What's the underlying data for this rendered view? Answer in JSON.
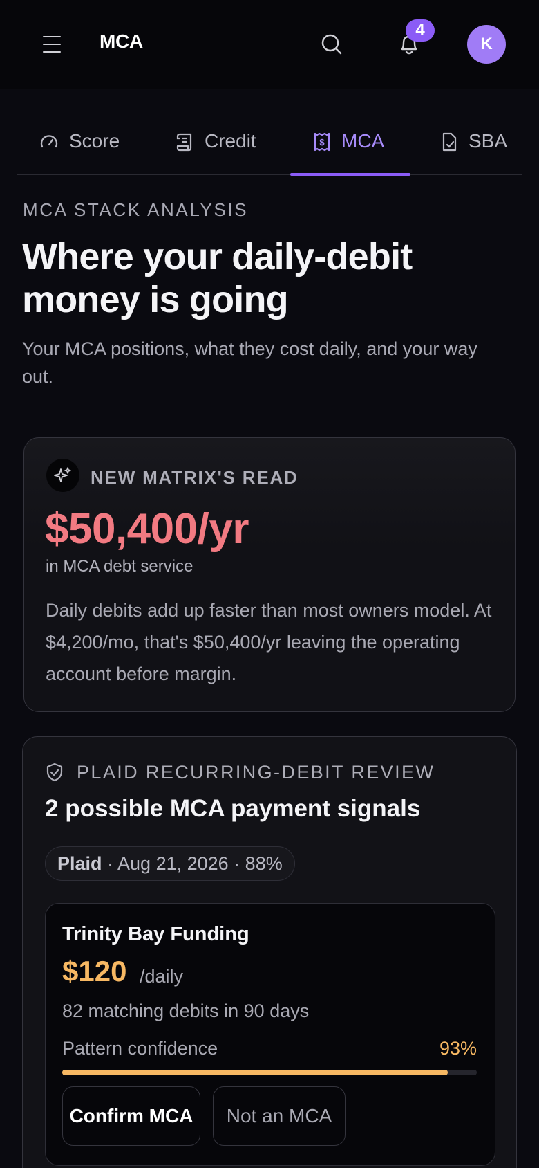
{
  "header": {
    "app_title": "MCA",
    "notification_count": "4",
    "avatar_initial": "K",
    "icons": {
      "menu": "hamburger-icon",
      "search": "search-icon",
      "bell": "bell-icon"
    }
  },
  "tabs": [
    {
      "label": "Score",
      "icon": "gauge-icon",
      "active": false
    },
    {
      "label": "Credit",
      "icon": "scroll-icon",
      "active": false
    },
    {
      "label": "MCA",
      "icon": "receipt-icon",
      "active": true
    },
    {
      "label": "SBA",
      "icon": "document-check-icon",
      "active": false
    }
  ],
  "hero": {
    "eyebrow": "MCA STACK ANALYSIS",
    "title": "Where your daily-debit money is going",
    "subtitle": "Your MCA positions, what they cost daily, and your way out."
  },
  "matrix_card": {
    "label": "NEW MATRIX'S READ",
    "amount": "$50,400/yr",
    "caption": "in MCA debt service",
    "body": "Daily debits add up faster than most owners model. At $4,200/mo, that's $50,400/yr leaving the operating account before margin."
  },
  "plaid_card": {
    "label": "PLAID RECURRING-DEBIT REVIEW",
    "title": "2 possible MCA payment signals",
    "pill_source": "Plaid",
    "pill_rest": " · Aug 21, 2026 · 88%",
    "signal": {
      "lender": "Trinity Bay Funding",
      "amount": "$120",
      "unit": "/daily",
      "matches": "82 matching debits in 90 days",
      "confidence_label": "Pattern confidence",
      "confidence_value": "93%",
      "confidence_fraction": 0.93,
      "confirm_label": "Confirm MCA",
      "reject_label": "Not an MCA"
    }
  },
  "colors": {
    "accent": "#8b5cf6",
    "amount_red": "#f27a82",
    "amount_orange": "#f7b863",
    "background": "#0a0a10"
  }
}
